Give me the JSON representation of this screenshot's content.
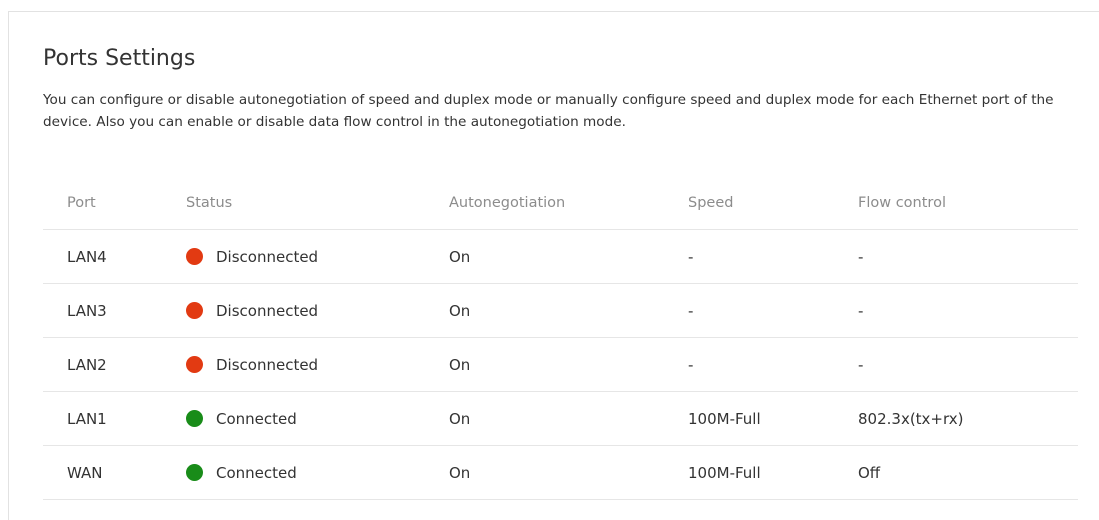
{
  "page": {
    "title": "Ports Settings",
    "description": "You can configure or disable autonegotiation of speed and duplex mode or manually configure speed and duplex mode for each Ethernet port of the device. Also you can enable or disable data flow control in the autonegotiation mode."
  },
  "colors": {
    "disconnected": "#e23a12",
    "connected": "#198c19"
  },
  "table": {
    "headers": {
      "port": "Port",
      "status": "Status",
      "autonegotiation": "Autonegotiation",
      "speed": "Speed",
      "flow_control": "Flow control"
    },
    "rows": [
      {
        "port": "LAN4",
        "status": "Disconnected",
        "status_key": "disconnected",
        "autonegotiation": "On",
        "speed": "-",
        "flow_control": "-"
      },
      {
        "port": "LAN3",
        "status": "Disconnected",
        "status_key": "disconnected",
        "autonegotiation": "On",
        "speed": "-",
        "flow_control": "-"
      },
      {
        "port": "LAN2",
        "status": "Disconnected",
        "status_key": "disconnected",
        "autonegotiation": "On",
        "speed": "-",
        "flow_control": "-"
      },
      {
        "port": "LAN1",
        "status": "Connected",
        "status_key": "connected",
        "autonegotiation": "On",
        "speed": "100M-Full",
        "flow_control": "802.3x(tx+rx)"
      },
      {
        "port": "WAN",
        "status": "Connected",
        "status_key": "connected",
        "autonegotiation": "On",
        "speed": "100M-Full",
        "flow_control": "Off"
      }
    ]
  }
}
